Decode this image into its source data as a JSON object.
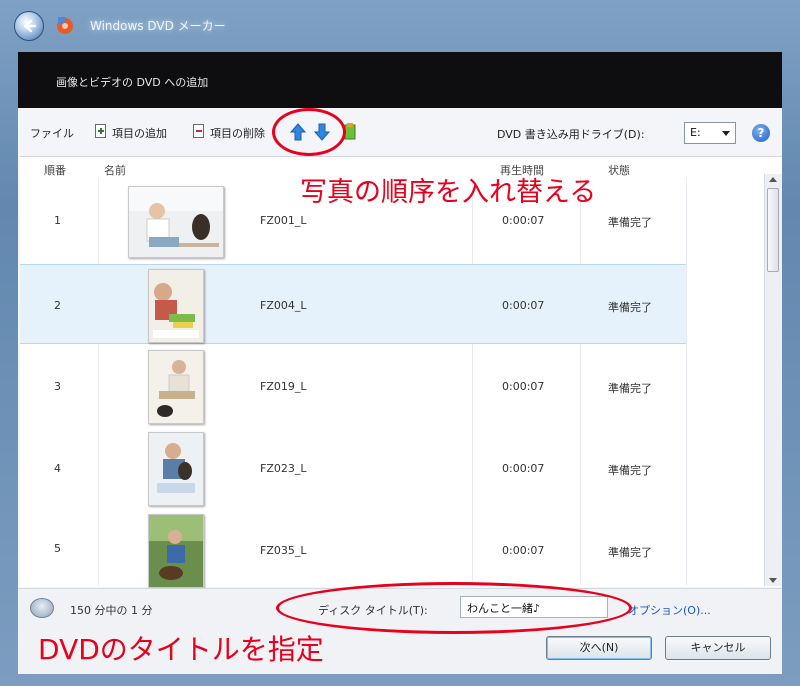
{
  "window": {
    "title": "Windows DVD メーカー",
    "header": "画像とビデオの DVD への追加"
  },
  "toolbar": {
    "file_label": "ファイル",
    "add_label": "項目の追加",
    "remove_label": "項目の削除",
    "drive_label": "DVD 書き込み用ドライブ(D):",
    "drive_value": "E:"
  },
  "columns": {
    "order": "順番",
    "name": "名前",
    "duration": "再生時間",
    "status": "状態"
  },
  "rows": [
    {
      "order": "1",
      "name": "FZ001_L",
      "duration": "0:00:07",
      "status": "準備完了"
    },
    {
      "order": "2",
      "name": "FZ004_L",
      "duration": "0:00:07",
      "status": "準備完了"
    },
    {
      "order": "3",
      "name": "FZ019_L",
      "duration": "0:00:07",
      "status": "準備完了"
    },
    {
      "order": "4",
      "name": "FZ023_L",
      "duration": "0:00:07",
      "status": "準備完了"
    },
    {
      "order": "5",
      "name": "FZ035_L",
      "duration": "0:00:07",
      "status": "準備完了"
    }
  ],
  "footer": {
    "capacity": "150 分中の 1 分",
    "disc_title_label": "ディスク タイトル(T):",
    "disc_title_value": "わんこと一緒♪",
    "options_link": "オプション(O)...",
    "next_button": "次へ(N)",
    "cancel_button": "キャンセル"
  },
  "annotations": {
    "reorder_note": "写真の順序を入れ替える",
    "title_note": "DVDのタイトルを指定"
  },
  "colors": {
    "annotation": "#e8001c",
    "selection": "#e6f2fb",
    "header": "#0e0e10"
  }
}
